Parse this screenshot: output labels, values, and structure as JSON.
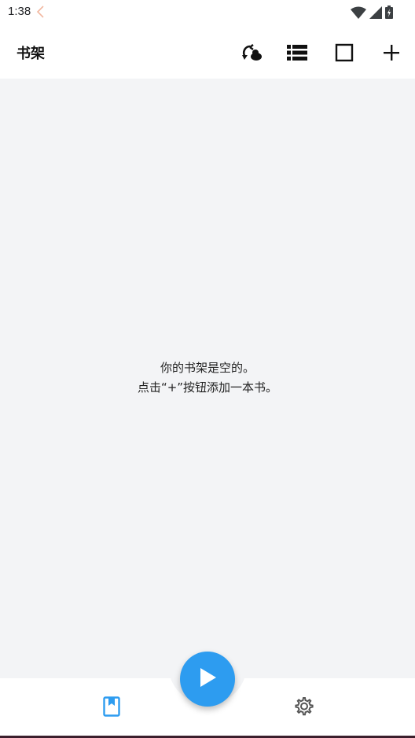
{
  "status_bar": {
    "time": "1:38",
    "back_icon": "chevron-left-icon",
    "icons": [
      "wifi-icon",
      "signal-icon",
      "battery-icon"
    ]
  },
  "app_bar": {
    "title": "书架",
    "actions": [
      "cloud-sync-icon",
      "list-view-icon",
      "select-square-icon",
      "add-icon"
    ]
  },
  "empty_state": {
    "line1": "你的书架是空的。",
    "line2": "点击“+”按钮添加一本书。"
  },
  "bottom_nav": {
    "items": [
      "bookshelf-icon",
      "settings-icon"
    ],
    "fab_icon": "play-icon"
  },
  "colors": {
    "accent": "#2d9cf0",
    "background": "#f3f4f6",
    "surface": "#ffffff",
    "back_chevron": "#f2b8a0"
  }
}
